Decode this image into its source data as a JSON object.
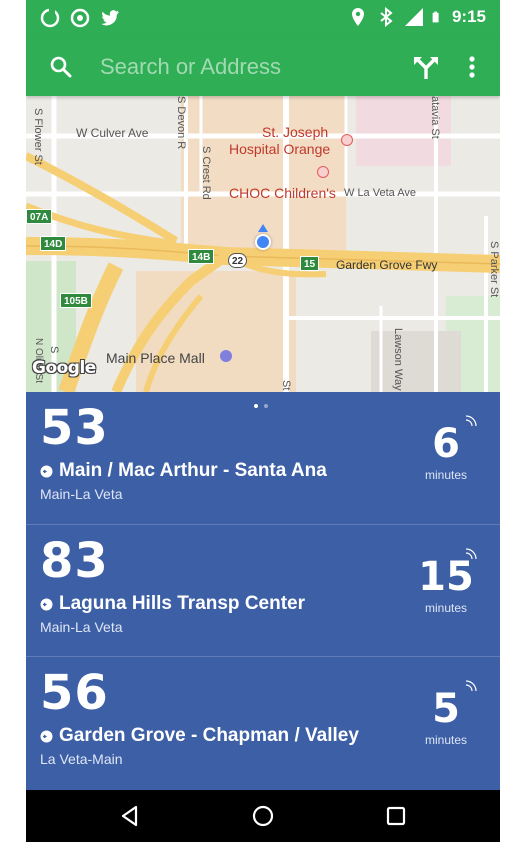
{
  "status_bar": {
    "time": "9:15",
    "icons": [
      "notification-icon",
      "hotspot-icon",
      "twitter-icon",
      "location-icon",
      "bluetooth-icon",
      "signal-icon",
      "battery-icon"
    ]
  },
  "toolbar": {
    "search_placeholder": "Search or Address",
    "icons": [
      "search-icon",
      "directions-icon",
      "more-vert-icon"
    ]
  },
  "map": {
    "labels": {
      "w_culver": "W Culver Ave",
      "s_flower": "S Flower St",
      "s_devon": "S Devon R",
      "s_crest": "S Crest Rd",
      "st_joseph_1": "St. Joseph",
      "st_joseph_2": "Hospital Orange",
      "choc": "CHOC Children's",
      "w_la_veta": "W La Veta Ave",
      "s_batavia": "atavia St",
      "s_parker": "S Parker St",
      "garden_grove_fwy": "Garden Grove Fwy",
      "main_place_mall": "Main Place Mall",
      "lawson_way": "Lawson Way",
      "n_olive": "N Olive St",
      "st_bottom": "St",
      "s_partial": "S"
    },
    "shields": {
      "s07a": "07A",
      "s14d": "14D",
      "s14b": "14B",
      "s22": "22",
      "s15": "15",
      "s105b": "105B"
    },
    "attribution": "Google",
    "pager": {
      "count": 2,
      "active": 0
    }
  },
  "arrivals": [
    {
      "route": "53",
      "destination": "Main / Mac Arthur - Santa Ana",
      "stop": "Main-La Veta",
      "eta": "6",
      "eta_unit": "minutes"
    },
    {
      "route": "83",
      "destination": "Laguna Hills Transp Center",
      "stop": "Main-La Veta",
      "eta": "15",
      "eta_unit": "minutes"
    },
    {
      "route": "56",
      "destination": "Garden Grove - Chapman / Valley",
      "stop": "La Veta-Main",
      "eta": "5",
      "eta_unit": "minutes"
    }
  ],
  "nav_bar": {
    "icons": [
      "back-icon",
      "home-icon",
      "recents-icon"
    ]
  },
  "colors": {
    "brand_green": "#2fae55",
    "card_blue": "#3d5fa6",
    "map_background": "#eeebe6",
    "highway_orange": "#f6cf75",
    "location_blue": "#4285f4"
  }
}
